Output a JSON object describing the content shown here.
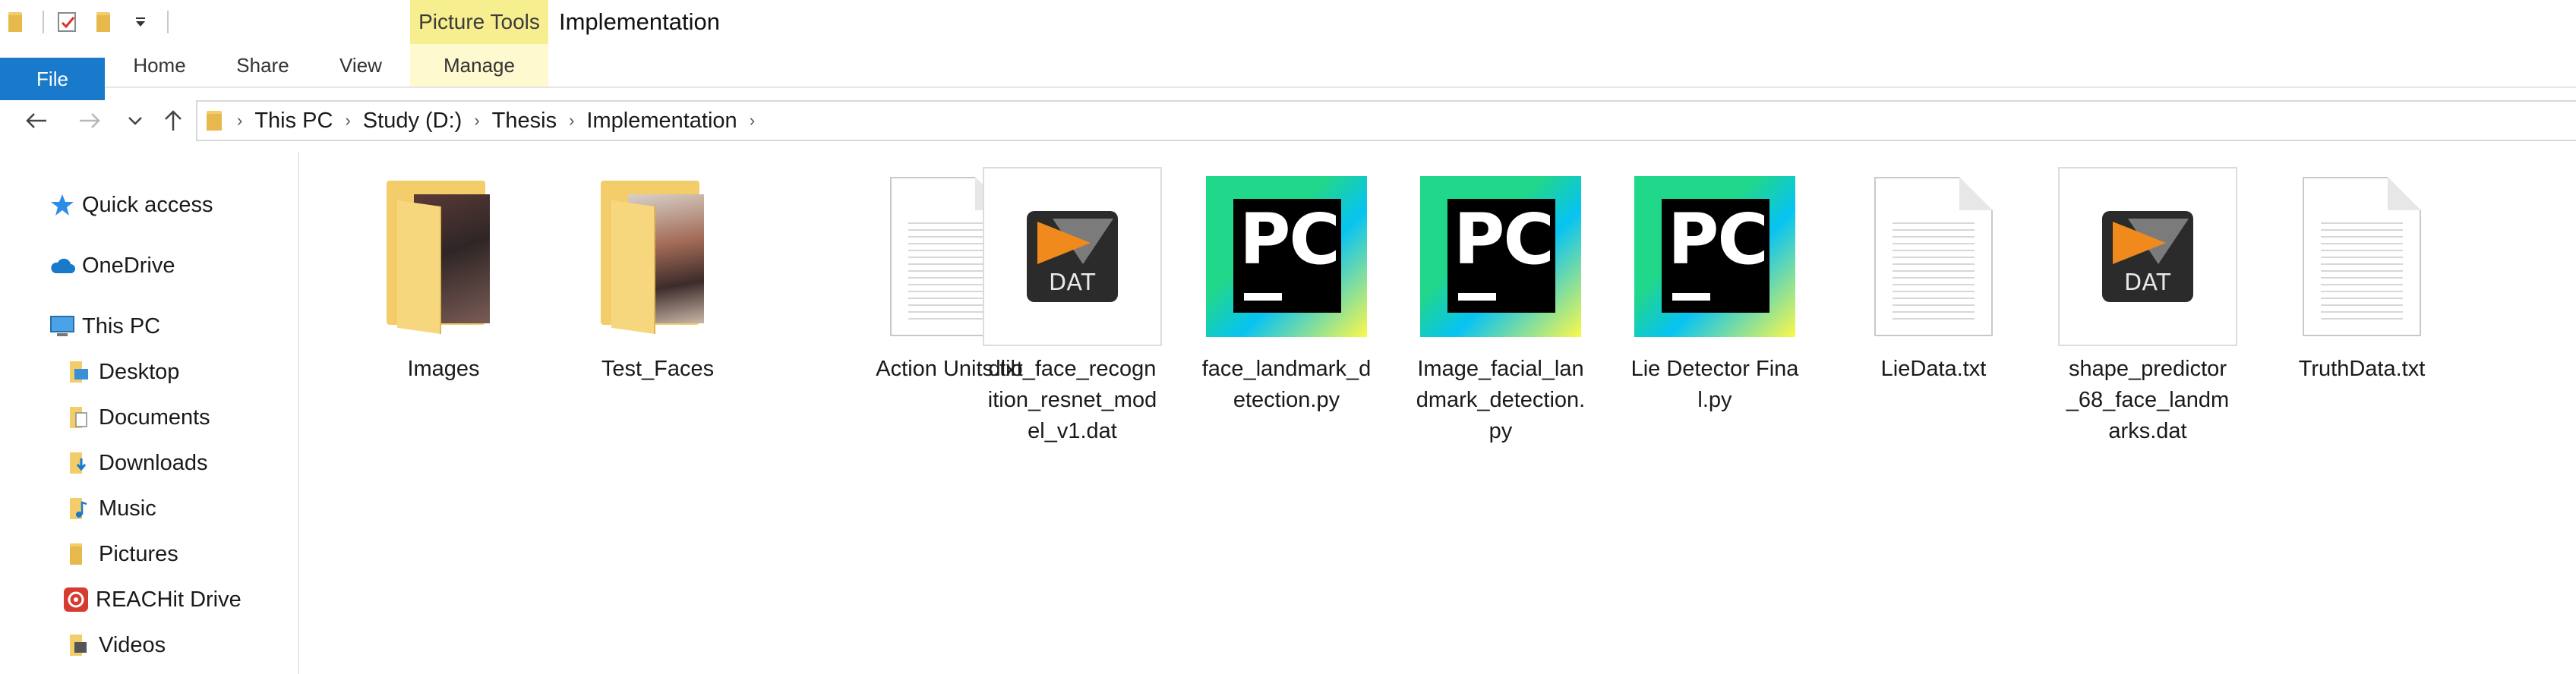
{
  "title_bar": {
    "context_tab": "Picture Tools",
    "window_title": "Implementation"
  },
  "ribbon": {
    "tabs": [
      "File",
      "Home",
      "Share",
      "View",
      "Manage"
    ]
  },
  "address": {
    "breadcrumbs": [
      "This PC",
      "Study (D:)",
      "Thesis",
      "Implementation"
    ]
  },
  "sidebar": {
    "items": [
      {
        "label": "Quick access",
        "icon": "star-icon"
      },
      {
        "label": "OneDrive",
        "icon": "cloud-icon"
      },
      {
        "label": "This PC",
        "icon": "computer-icon"
      },
      {
        "label": "Desktop",
        "icon": "desktop-folder-icon"
      },
      {
        "label": "Documents",
        "icon": "documents-folder-icon"
      },
      {
        "label": "Downloads",
        "icon": "downloads-folder-icon"
      },
      {
        "label": "Music",
        "icon": "music-folder-icon"
      },
      {
        "label": "Pictures",
        "icon": "pictures-folder-icon"
      },
      {
        "label": "REACHit Drive",
        "icon": "reachit-drive-icon"
      },
      {
        "label": "Videos",
        "icon": "videos-folder-icon"
      }
    ]
  },
  "files": [
    {
      "name": "Images",
      "kind": "folder"
    },
    {
      "name": "Test_Faces",
      "kind": "folder"
    },
    {
      "name": "Action Units.txt",
      "kind": "text"
    },
    {
      "name": "dlib_face_recognition_resnet_model_v1.dat",
      "kind": "dat"
    },
    {
      "name": "face_landmark_detection.py",
      "kind": "python"
    },
    {
      "name": "Image_facial_landmark_detection.py",
      "kind": "python"
    },
    {
      "name": "Lie Detector Final.py",
      "kind": "python"
    },
    {
      "name": "LieData.txt",
      "kind": "text"
    },
    {
      "name": "shape_predictor_68_face_landmarks.dat",
      "kind": "dat"
    },
    {
      "name": "TruthData.txt",
      "kind": "text"
    }
  ],
  "icon_labels": {
    "dat": "DAT",
    "python": "PC"
  },
  "colors": {
    "file_tab": "#1979ca",
    "picture_tools": "#f6ee8f",
    "folder": "#f2cd6a"
  }
}
